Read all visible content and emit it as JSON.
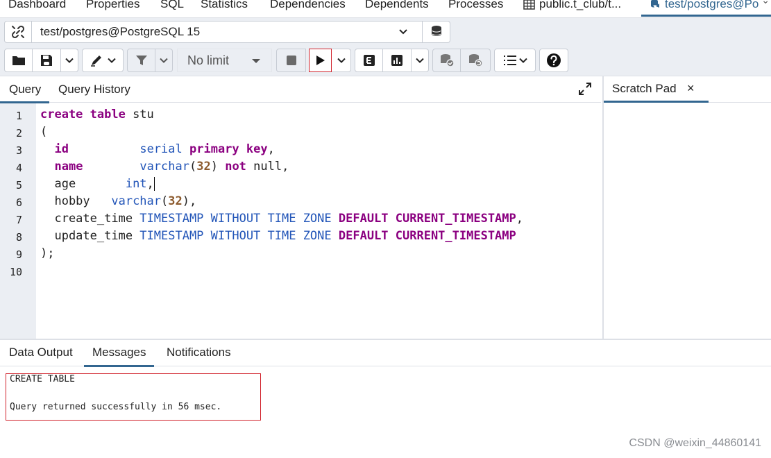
{
  "top_tabs": [
    "Dashboard",
    "Properties",
    "SQL",
    "Statistics",
    "Dependencies",
    "Dependents",
    "Processes",
    "public.t_club/t...",
    "test/postgres@Po"
  ],
  "connection": {
    "value": "test/postgres@PostgreSQL 15"
  },
  "toolbar": {
    "limit_label": "No limit"
  },
  "query_tabs": {
    "query": "Query",
    "history": "Query History"
  },
  "scratch_pad": {
    "title": "Scratch Pad",
    "close": "×"
  },
  "editor": {
    "line_numbers": [
      "1",
      "2",
      "3",
      "4",
      "5",
      "6",
      "7",
      "8",
      "9",
      "10"
    ],
    "lines": [
      [
        {
          "t": "create table",
          "c": "kw"
        },
        {
          "t": " stu",
          "c": ""
        }
      ],
      [
        {
          "t": "(",
          "c": ""
        }
      ],
      [
        {
          "t": "  ",
          "c": ""
        },
        {
          "t": "id",
          "c": "kw"
        },
        {
          "t": "          ",
          "c": ""
        },
        {
          "t": "serial",
          "c": "ty"
        },
        {
          "t": " ",
          "c": ""
        },
        {
          "t": "primary key",
          "c": "kw"
        },
        {
          "t": ",",
          "c": ""
        }
      ],
      [
        {
          "t": "  ",
          "c": ""
        },
        {
          "t": "name",
          "c": "kw"
        },
        {
          "t": "        ",
          "c": ""
        },
        {
          "t": "varchar",
          "c": "ty"
        },
        {
          "t": "(",
          "c": ""
        },
        {
          "t": "32",
          "c": "nu"
        },
        {
          "t": ") ",
          "c": ""
        },
        {
          "t": "not",
          "c": "kw"
        },
        {
          "t": " null,",
          "c": ""
        }
      ],
      [
        {
          "t": "  age       ",
          "c": ""
        },
        {
          "t": "int",
          "c": "ty"
        },
        {
          "t": ",",
          "c": ""
        }
      ],
      [
        {
          "t": "  hobby   ",
          "c": ""
        },
        {
          "t": "varchar",
          "c": "ty"
        },
        {
          "t": "(",
          "c": ""
        },
        {
          "t": "32",
          "c": "nu"
        },
        {
          "t": "),",
          "c": ""
        }
      ],
      [
        {
          "t": "  create_time ",
          "c": ""
        },
        {
          "t": "TIMESTAMP WITHOUT TIME ZONE",
          "c": "ty"
        },
        {
          "t": " ",
          "c": ""
        },
        {
          "t": "DEFAULT CURRENT_TIMESTAMP",
          "c": "kw"
        },
        {
          "t": ",",
          "c": ""
        }
      ],
      [
        {
          "t": "  update_time ",
          "c": ""
        },
        {
          "t": "TIMESTAMP WITHOUT TIME ZONE",
          "c": "ty"
        },
        {
          "t": " ",
          "c": ""
        },
        {
          "t": "DEFAULT CURRENT_TIMESTAMP",
          "c": "kw"
        }
      ],
      [
        {
          "t": ");",
          "c": ""
        }
      ],
      []
    ]
  },
  "bottom_tabs": {
    "data_output": "Data Output",
    "messages": "Messages",
    "notifications": "Notifications"
  },
  "messages": {
    "line1": "CREATE TABLE",
    "line2": "Query returned successfully in 56 msec."
  },
  "watermark": "CSDN @weixin_44860141",
  "colors": {
    "accent": "#326690",
    "highlight": "#d0202a",
    "keyword": "#8b0080",
    "type": "#2255b8",
    "number": "#8c5a2d"
  }
}
